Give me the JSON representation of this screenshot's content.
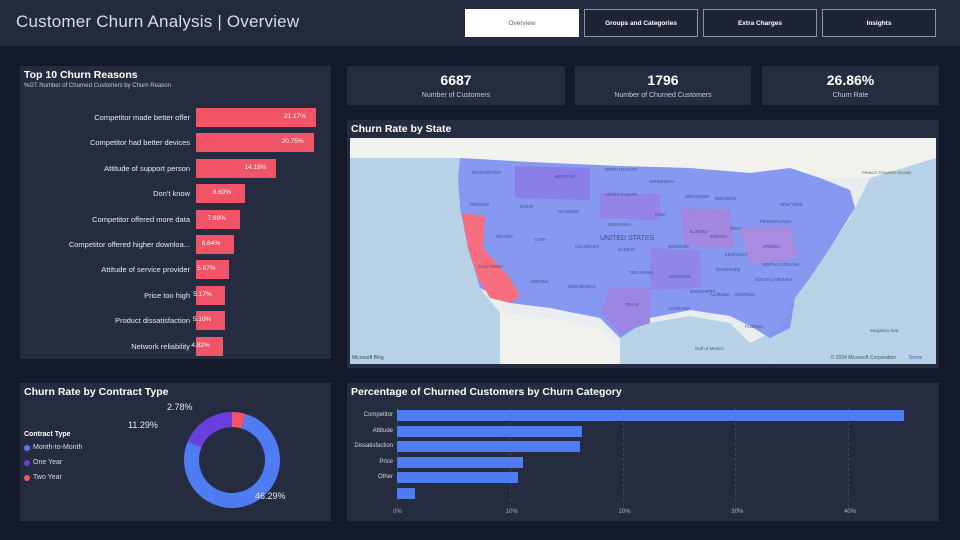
{
  "app": {
    "title": "Customer Churn Analysis | Overview"
  },
  "nav": {
    "tabs": [
      {
        "label": "Overview",
        "active": true
      },
      {
        "label": "Groups and Categories",
        "active": false
      },
      {
        "label": "Extra Charges",
        "active": false
      },
      {
        "label": "Insights",
        "active": false
      }
    ]
  },
  "reasons": {
    "title": "Top 10 Churn Reasons",
    "subtitle": "%GT Number of Churned Customers by Churn Reason",
    "color": "#f05466",
    "items": [
      {
        "label": "Competitor made better offer",
        "value": 21.17,
        "display": "21.17%"
      },
      {
        "label": "Competitor had better devices",
        "value": 20.75,
        "display": "20.75%"
      },
      {
        "label": "Attitude of support person",
        "value": 14.19,
        "display": "14.19%"
      },
      {
        "label": "Don't know",
        "value": 8.6,
        "display": "8.60%"
      },
      {
        "label": "Competitor offered more data",
        "value": 7.69,
        "display": "7.69%"
      },
      {
        "label": "Competitor offered higher downloa...",
        "value": 6.64,
        "display": "6.64%"
      },
      {
        "label": "Attitude of service provider",
        "value": 5.87,
        "display": "5.87%"
      },
      {
        "label": "Price too high",
        "value": 5.17,
        "display": "5.17%"
      },
      {
        "label": "Product dissatisfaction",
        "value": 5.1,
        "display": "5.10%"
      },
      {
        "label": "Network reliability",
        "value": 4.82,
        "display": "4.82%"
      }
    ]
  },
  "kpis": [
    {
      "value": "6687",
      "label": "Number of Customers"
    },
    {
      "value": "1796",
      "label": "Number of Churned Customers"
    },
    {
      "value": "26.86%",
      "label": "Churn Rate"
    }
  ],
  "map": {
    "title": "Churn Rate by State",
    "country_label": "UNITED STATES",
    "gulf_label": "Gulf of Mexico",
    "sea_label": "Sargasso Sea",
    "province_label": "PRINCE EDWARD ISLAND",
    "attribution": "© 2024 Microsoft Corporation",
    "terms": "Terms",
    "brand": "Microsoft Bing",
    "highlight_color": "#f56d7e",
    "base_color": "#7b8ef0",
    "states": [
      "WASHINGTON",
      "OREGON",
      "IDAHO",
      "MONTANA",
      "WYOMING",
      "NEVADA",
      "UTAH",
      "COLORADO",
      "CALIFORNIA",
      "ARIZONA",
      "NEW MEXICO",
      "NORTH DAKOTA",
      "SOUTH DAKOTA",
      "NEBRASKA",
      "KANSAS",
      "OKLAHOMA",
      "TEXAS",
      "MINNESOTA",
      "IOWA",
      "MISSOURI",
      "ARKANSAS",
      "LOUISIANA",
      "WISCONSIN",
      "ILLINOIS",
      "MICHIGAN",
      "INDIANA",
      "OHIO",
      "KENTUCKY",
      "TENNESSEE",
      "MISSISSIPPI",
      "ALABAMA",
      "GEORGIA",
      "FLORIDA",
      "SOUTH CAROLINA",
      "NORTH CAROLINA",
      "VIRGINIA",
      "PENNSYLVANIA",
      "NEW YORK"
    ]
  },
  "contract": {
    "title": "Churn Rate by Contract Type",
    "legend_title": "Contract Type",
    "items": [
      {
        "label": "Month-to-Month",
        "value": 46.29,
        "display": "46.29%",
        "color": "#4f7cf2"
      },
      {
        "label": "One Year",
        "value": 11.29,
        "display": "11.29%",
        "color": "#6a3fe0"
      },
      {
        "label": "Two Year",
        "value": 2.78,
        "display": "2.78%",
        "color": "#f05466"
      }
    ]
  },
  "chart_data": {
    "type": "bar",
    "title": "Percentage of Churned Customers by Churn Category",
    "orientation": "horizontal",
    "categories": [
      "Competitor",
      "Attitude",
      "Dissatisfaction",
      "Price",
      "Other",
      ""
    ],
    "values": [
      45,
      16.4,
      16.2,
      11.2,
      10.7,
      1.6
    ],
    "xlim": [
      0,
      47
    ],
    "x_ticks": [
      "0%",
      "10%",
      "20%",
      "30%",
      "40%"
    ],
    "grid": true,
    "color": "#4f7cf2"
  }
}
